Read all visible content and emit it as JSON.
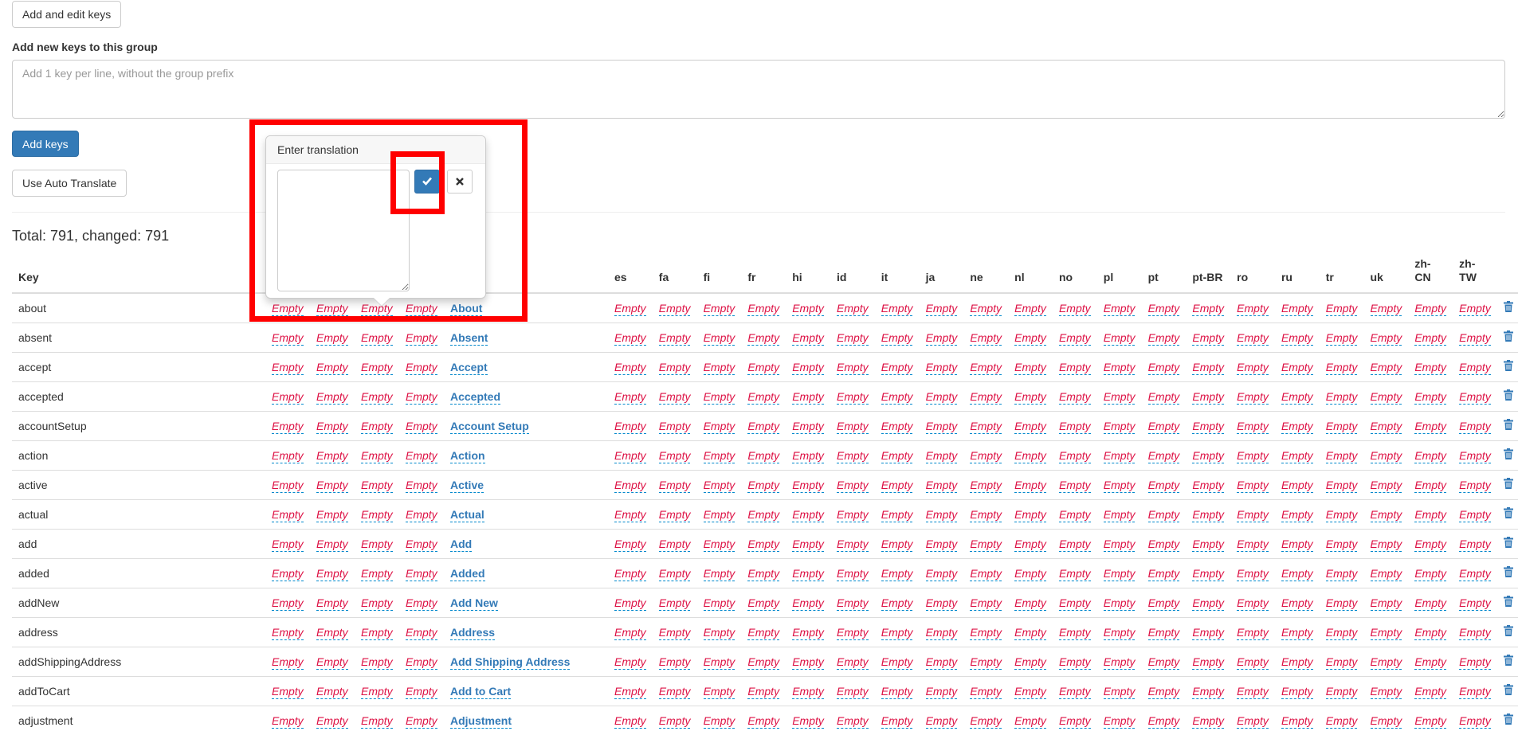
{
  "toolbar": {
    "add_edit_keys_label": "Add and edit keys",
    "add_keys_label": "Add keys",
    "auto_translate_label": "Use Auto Translate"
  },
  "new_keys": {
    "heading": "Add new keys to this group",
    "placeholder": "Add 1 key per line, without the group prefix"
  },
  "summary": "Total: 791, changed: 791",
  "table": {
    "key_header": "Key",
    "hidden_columns": [
      "",
      "",
      "",
      "",
      ""
    ],
    "languages": [
      "es",
      "fa",
      "fi",
      "fr",
      "hi",
      "id",
      "it",
      "ja",
      "ne",
      "nl",
      "no",
      "pl",
      "pt",
      "pt-BR",
      "ro",
      "ru",
      "tr",
      "uk",
      "zh-CN",
      "zh-TW"
    ],
    "empty_label": "Empty",
    "rows": [
      {
        "key": "about",
        "value": "About"
      },
      {
        "key": "absent",
        "value": "Absent"
      },
      {
        "key": "accept",
        "value": "Accept"
      },
      {
        "key": "accepted",
        "value": "Accepted"
      },
      {
        "key": "accountSetup",
        "value": "Account Setup"
      },
      {
        "key": "action",
        "value": "Action"
      },
      {
        "key": "active",
        "value": "Active"
      },
      {
        "key": "actual",
        "value": "Actual"
      },
      {
        "key": "add",
        "value": "Add"
      },
      {
        "key": "added",
        "value": "Added"
      },
      {
        "key": "addNew",
        "value": "Add New"
      },
      {
        "key": "address",
        "value": "Address"
      },
      {
        "key": "addShippingAddress",
        "value": "Add Shipping Address"
      },
      {
        "key": "addToCart",
        "value": "Add to Cart"
      },
      {
        "key": "adjustment",
        "value": "Adjustment"
      }
    ]
  },
  "popover": {
    "title": "Enter translation",
    "ok_icon": "check-icon",
    "cancel_icon": "close-icon"
  },
  "colors": {
    "primary": "#337ab7",
    "empty_text": "#dd1144",
    "highlight": "#ff0000"
  }
}
